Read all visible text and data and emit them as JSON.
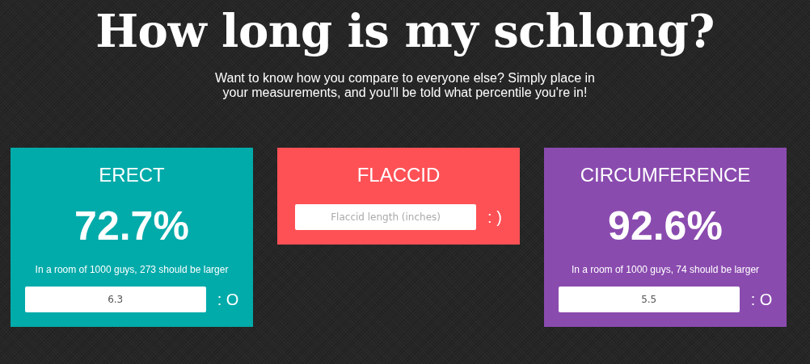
{
  "header": {
    "title": "How long is my schlong?",
    "subtitle": "Want to know how you compare to everyone else? Simply place in your measurements, and you'll be told what percentile you're in!"
  },
  "cards": [
    {
      "title": "ERECT",
      "color": "#00abaa",
      "percentile": "72.7%",
      "note": "In a room of 1000 guys, 273 should be larger",
      "value": "6.3",
      "face": ": O"
    },
    {
      "title": "FLACCID",
      "color": "#fe5156",
      "placeholder": "Flaccid length (inches)",
      "face": ": )"
    },
    {
      "title": "CIRCUMFERENCE",
      "color": "#8a4baf",
      "percentile": "92.6%",
      "note": "In a room of 1000 guys, 74 should be larger",
      "value": "5.5",
      "face": ": O"
    }
  ]
}
